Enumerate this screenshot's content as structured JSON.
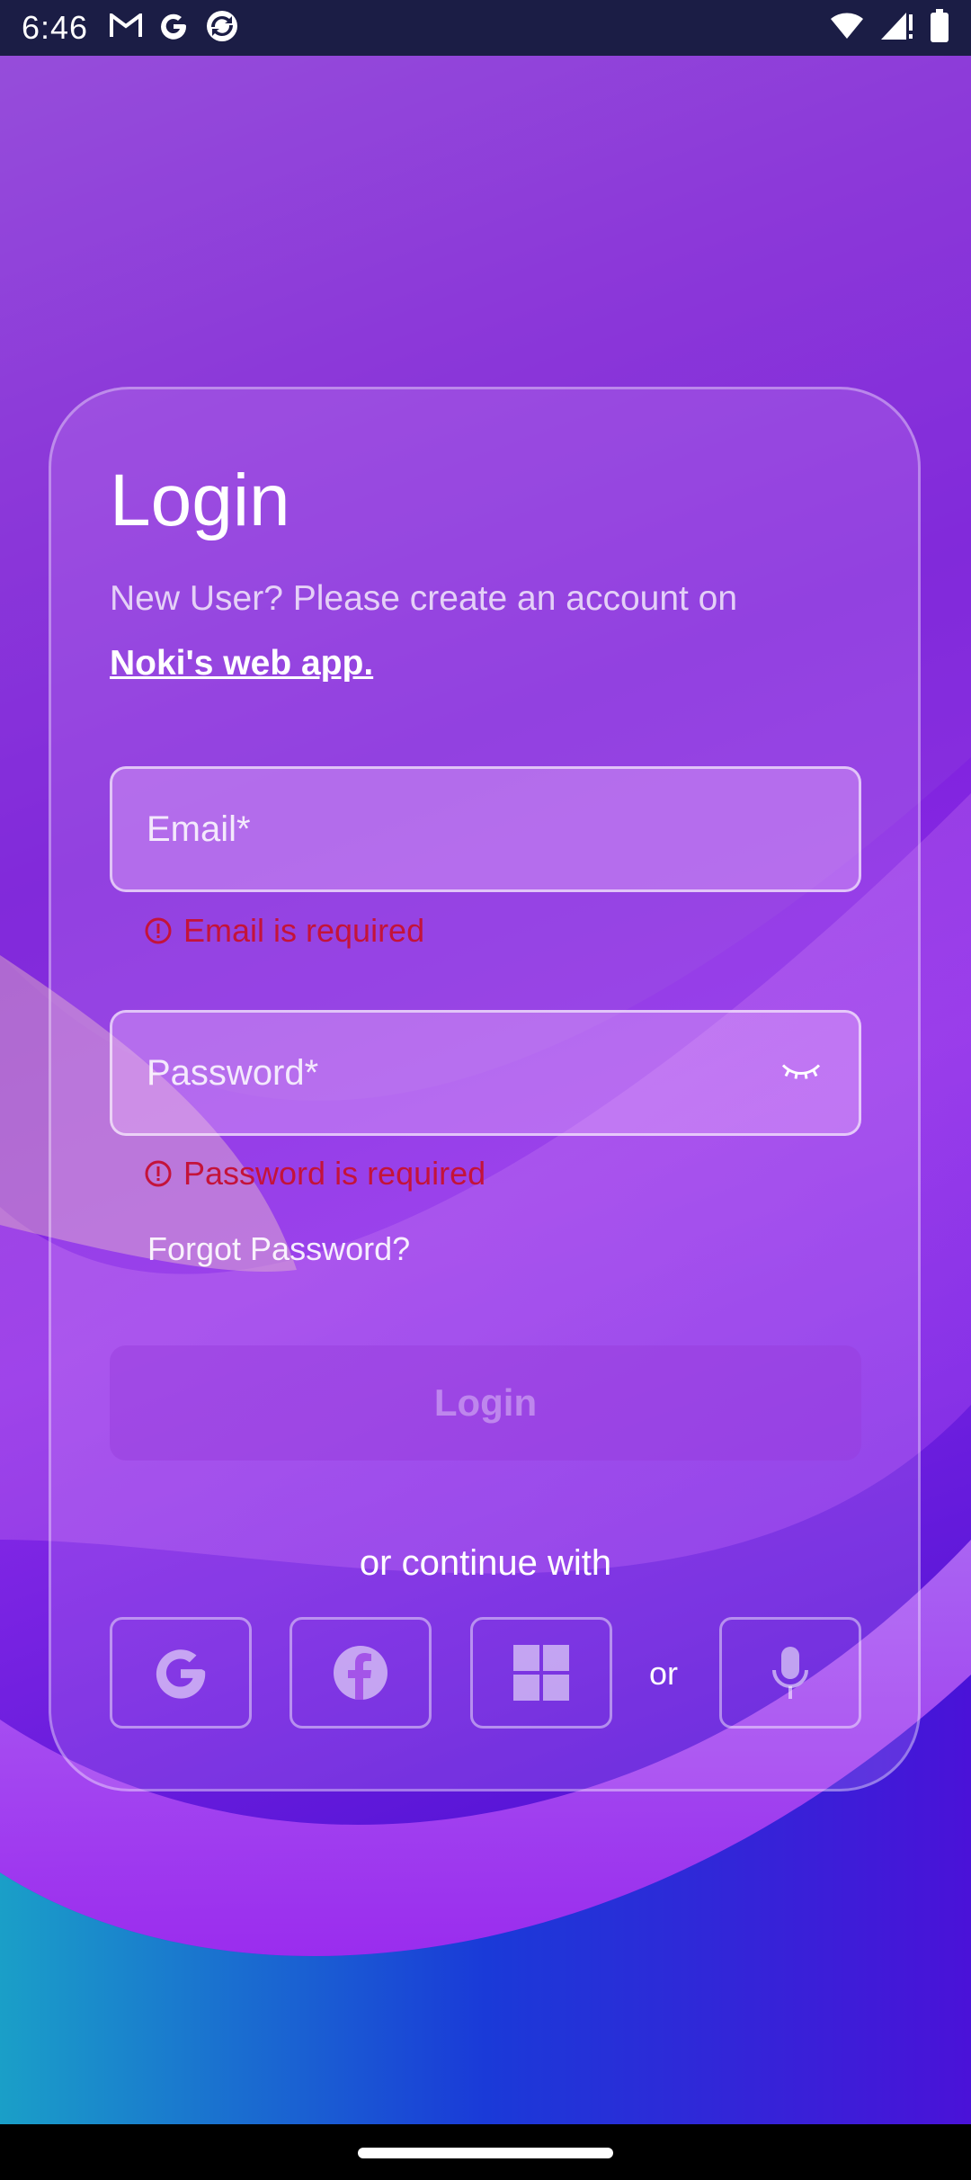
{
  "status_bar": {
    "time": "6:46",
    "left_icons": [
      "gmail-icon",
      "google-icon",
      "sync-app-icon"
    ],
    "right_icons": [
      "wifi-icon",
      "signal-icon",
      "battery-icon"
    ]
  },
  "login": {
    "title": "Login",
    "subtitle": "New User? Please create an account on",
    "web_link": "Noki's web app.",
    "email_placeholder": "Email*",
    "email_error": "Email is required",
    "password_placeholder": "Password*",
    "password_error": "Password is required",
    "forgot_password": "Forgot Password?",
    "login_button": "Login",
    "continue_text": "or continue with",
    "or_text": "or",
    "social_buttons": [
      "google-icon",
      "facebook-icon",
      "windows-icon",
      "microphone-icon"
    ]
  },
  "colors": {
    "error": "#c4133a",
    "status_bar": "#1b1d45"
  }
}
